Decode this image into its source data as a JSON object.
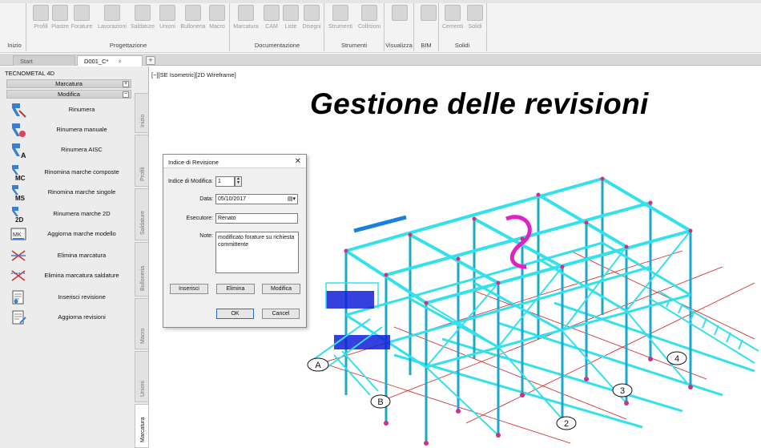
{
  "ribbon": {
    "groups": [
      {
        "name": "Inizio",
        "items": []
      },
      {
        "name": "Progettazione",
        "items": [
          "Profili",
          "Piastre",
          "Forature",
          "Lavorazioni",
          "Saldature",
          "Unioni",
          "Bulloneria",
          "Macro"
        ]
      },
      {
        "name": "Documentazione",
        "items": [
          "Marcatura",
          "CAM",
          "Liste",
          "Disegni"
        ]
      },
      {
        "name": "Strumenti",
        "items": [
          "Strumenti",
          "Collisioni"
        ]
      },
      {
        "name": "Visualizza",
        "items": [
          ""
        ]
      },
      {
        "name": "BIM",
        "items": [
          ""
        ]
      },
      {
        "name": "Solidi",
        "items": [
          "Cementi",
          "Solidi"
        ]
      }
    ]
  },
  "tabs": {
    "start": "Start",
    "doc": "D001_C*",
    "close": "×",
    "add": "+"
  },
  "panel": {
    "title": "TECNOMETAL 4D",
    "section_marcatura": "Marcatura",
    "section_modifica": "Modifica",
    "toggle_collapsed": "+",
    "toggle_expanded": "−",
    "commands": [
      {
        "label": "Rinumera",
        "icon": "renumber-icon"
      },
      {
        "label": "Rinumera manuale",
        "icon": "renumber-manual-icon"
      },
      {
        "label": "Rinumera AISC",
        "icon": "renumber-aisc-icon"
      },
      {
        "label": "Rinomina marche composte",
        "icon": "rename-mc-icon"
      },
      {
        "label": "Rinomina marche singole",
        "icon": "rename-ms-icon"
      },
      {
        "label": "Rinumera marche 2D",
        "icon": "renumber-2d-icon"
      },
      {
        "label": "Aggiorna marche modello",
        "icon": "update-marks-icon"
      },
      {
        "label": "Elimina marcatura",
        "icon": "delete-marking-icon"
      },
      {
        "label": "Elimina marcatura saldature",
        "icon": "delete-weld-marking-icon"
      },
      {
        "label": "Inserisci revisione",
        "icon": "insert-revision-icon"
      },
      {
        "label": "Aggiorna revisioni",
        "icon": "update-revisions-icon"
      }
    ],
    "vtabs": [
      "Inizio",
      "Profili",
      "Saldature",
      "Bulloneria",
      "Macro",
      "Unioni",
      "Marcatura"
    ]
  },
  "viewport": {
    "label": "[−][SE Isometric][2D Wireframe]",
    "title": "Gestione delle revisioni",
    "grid_labels": [
      "A",
      "B",
      "2",
      "3",
      "4"
    ]
  },
  "dialog": {
    "title": "Indice di Revisione",
    "close": "✕",
    "index_label": "Indice di Modifica:",
    "index_value": "1",
    "date_label": "Data:",
    "date_value": "05/10/2017",
    "executor_label": "Esecutore:",
    "executor_value": "Renato",
    "notes_label": "Note:",
    "notes_value": "modificato forature su richiesta committente",
    "btn_insert": "Inserisci",
    "btn_delete": "Elimina",
    "btn_modify": "Modifica",
    "btn_ok": "OK",
    "btn_cancel": "Cancel"
  },
  "colors": {
    "structure": "#33e0ee",
    "structure_dark": "#1aa9c8",
    "accent_magenta": "#e020c8",
    "accent_blue": "#1020d8",
    "nodes": "#d03080",
    "grid_red": "#d02020"
  }
}
